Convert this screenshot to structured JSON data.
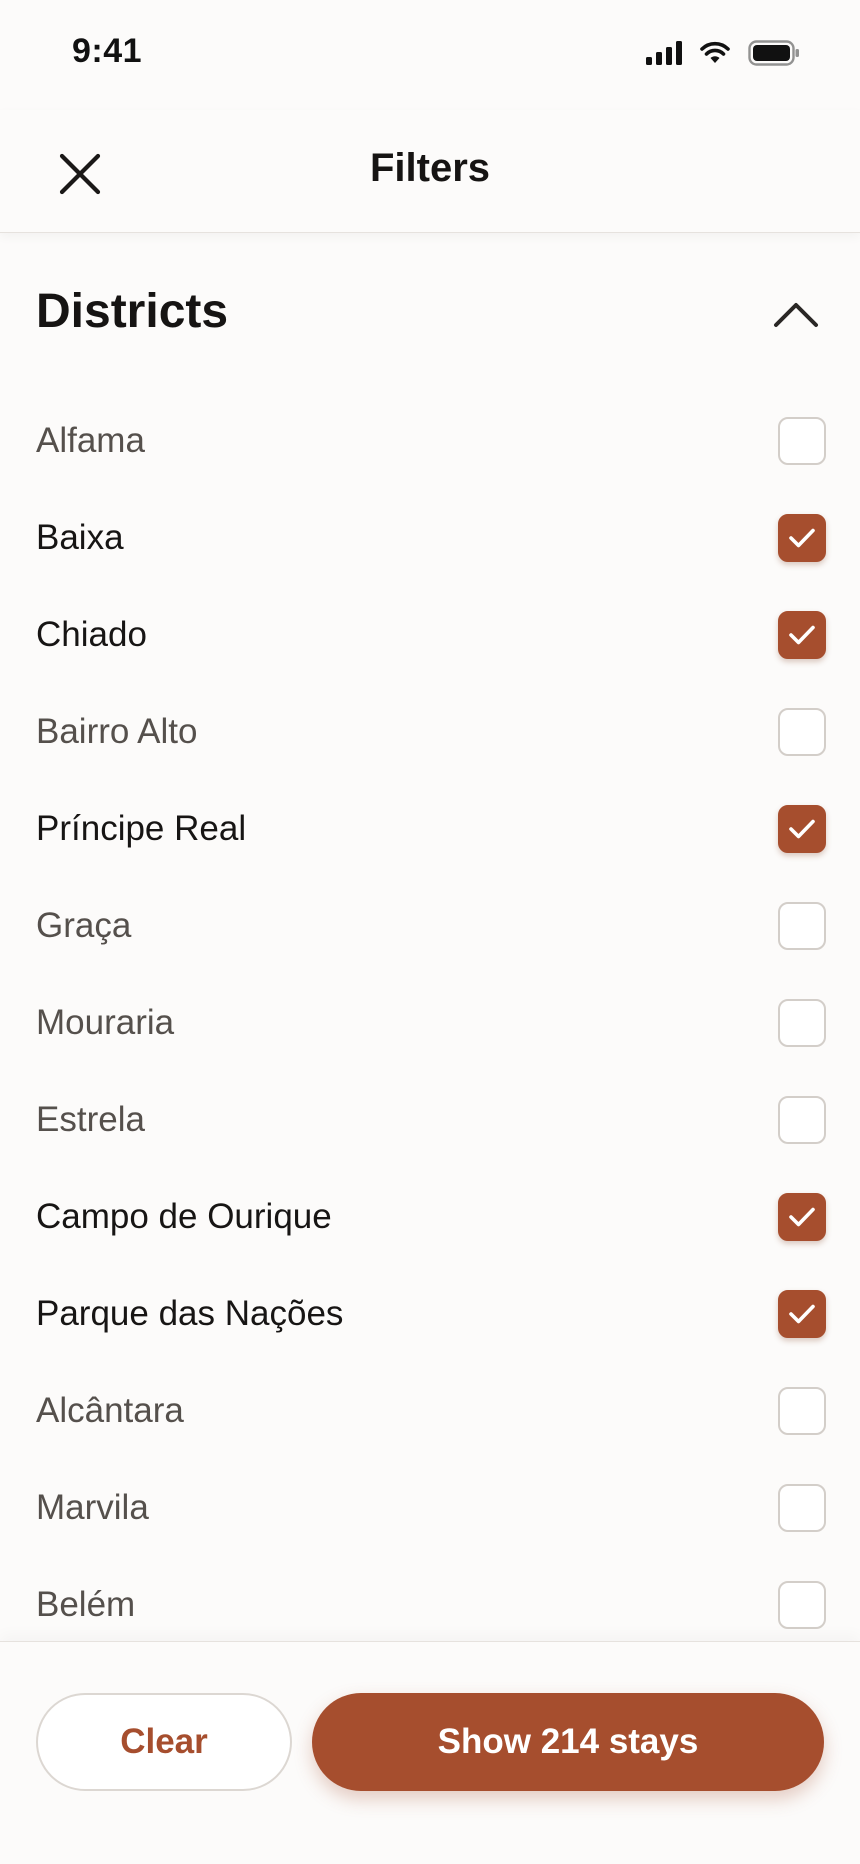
{
  "status_bar": {
    "time": "9:41",
    "icons": [
      "signal-icon",
      "wifi-icon",
      "battery-icon"
    ]
  },
  "header": {
    "title": "Filters",
    "close_icon": "close-icon"
  },
  "section": {
    "title": "Districts",
    "toggle_icon": "chevron-up-icon"
  },
  "districts": [
    {
      "label": "Alfama",
      "checked": false
    },
    {
      "label": "Baixa",
      "checked": true
    },
    {
      "label": "Chiado",
      "checked": true
    },
    {
      "label": "Bairro Alto",
      "checked": false
    },
    {
      "label": "Príncipe Real",
      "checked": true
    },
    {
      "label": "Graça",
      "checked": false
    },
    {
      "label": "Mouraria",
      "checked": false
    },
    {
      "label": "Estrela",
      "checked": false
    },
    {
      "label": "Campo de Ourique",
      "checked": true
    },
    {
      "label": "Parque das Nações",
      "checked": true
    },
    {
      "label": "Alcântara",
      "checked": false
    },
    {
      "label": "Marvila",
      "checked": false
    },
    {
      "label": "Belém",
      "checked": false
    }
  ],
  "footer": {
    "clear_label": "Clear",
    "show_label": "Show 214 stays"
  },
  "colors": {
    "accent": "#A64E2E",
    "background": "#FCFBFA",
    "text_primary": "#171514",
    "text_secondary": "#55504C",
    "checkbox_border": "#D3CEC9"
  }
}
